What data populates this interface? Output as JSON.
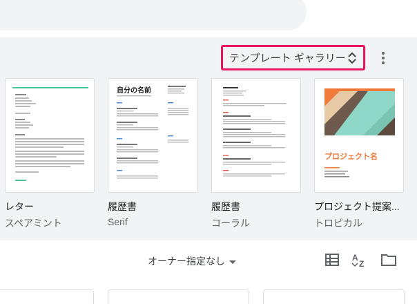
{
  "gallery": {
    "header_label": "テンプレート ギャラリー",
    "templates": [
      {
        "title": "レター",
        "subtitle": "スペアミント",
        "thumb": "letter"
      },
      {
        "title": "履歴書",
        "subtitle": "Serif",
        "thumb": "resume-serif",
        "heading": "自分の名前"
      },
      {
        "title": "履歴書",
        "subtitle": "コーラル",
        "thumb": "resume-coral"
      },
      {
        "title": "プロジェクト提案...",
        "subtitle": "トロピカル",
        "thumb": "proposal",
        "heading": "プロジェクト名"
      }
    ]
  },
  "toolbar": {
    "owner_filter": "オーナー指定なし",
    "icons": [
      "list-view-icon",
      "sort-az-icon",
      "folder-icon"
    ]
  },
  "colors": {
    "highlight": "#e8175d",
    "gallery_bg": "#f1f3f4",
    "mint": "#4fc39b",
    "coral": "#e35b4b",
    "teal": "#8fd7c7",
    "orange": "#f07a3a"
  }
}
